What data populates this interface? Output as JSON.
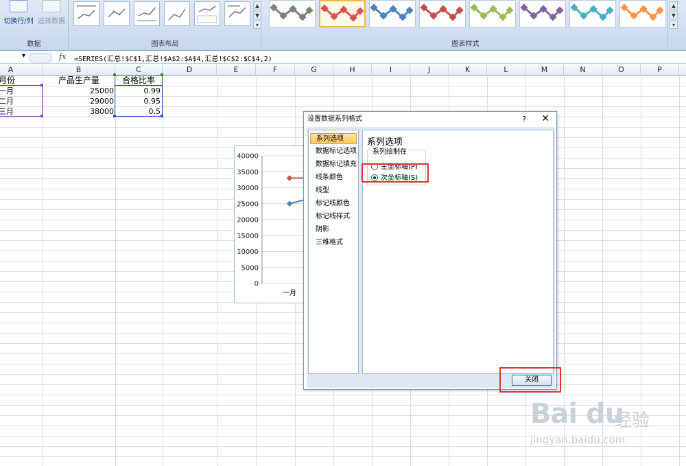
{
  "ribbon": {
    "data_group_label": "数据",
    "switch_row_col": "切换行/列",
    "select_data": "选择数据",
    "layout_group_label": "图表布局",
    "styles_group_label": "图表样式",
    "style_colors": [
      "#7f7f7f",
      "#d9534f",
      "#4f81bd",
      "#c0504d",
      "#9bbb59",
      "#8064a2",
      "#4bacc6",
      "#f79646"
    ],
    "selected_style_index": 1
  },
  "formula_bar": {
    "name_box": "",
    "fx": "fx",
    "formula": "=SERIES(汇总!$C$1,汇总!$A$2:$A$4,汇总!$C$2:$C$4,2)"
  },
  "columns": [
    "A",
    "B",
    "C",
    "D",
    "E",
    "F",
    "G",
    "H",
    "I",
    "J",
    "K",
    "L",
    "M",
    "N",
    "O",
    "P"
  ],
  "sheet": {
    "headers": {
      "a": "月份",
      "b": "产品生产量",
      "c": "合格比率"
    },
    "rows": [
      {
        "a": "一月",
        "b": "25000",
        "c": "0.99"
      },
      {
        "a": "二月",
        "b": "29000",
        "c": "0.95"
      },
      {
        "a": "三月",
        "b": "38000",
        "c": "0.5"
      }
    ]
  },
  "chart_data": {
    "type": "line",
    "y_ticks": [
      "40000",
      "35000",
      "30000",
      "25000",
      "20000",
      "15000",
      "10000",
      "5000",
      "0"
    ],
    "ylim": [
      0,
      40000
    ],
    "categories": [
      "一月"
    ],
    "series": [
      {
        "values": [
          25000
        ],
        "color": "#4f81bd"
      },
      {
        "values": [
          33000
        ],
        "color": "#c0504d"
      }
    ]
  },
  "dialog": {
    "title": "设置数据系列格式",
    "help": "?",
    "close": "✕",
    "nav": [
      "系列选项",
      "数据标记选项",
      "数据标记填充",
      "线条颜色",
      "线型",
      "标记线颜色",
      "标记线样式",
      "阴影",
      "三维格式"
    ],
    "active_nav": 0,
    "panel_title": "系列选项",
    "plot_on_label": "系列绘制在",
    "primary_axis": "主坐标轴(P)",
    "secondary_axis": "次坐标轴(S)",
    "selected_axis": "secondary",
    "close_button": "关闭"
  },
  "watermark": {
    "logo": "Bai du",
    "cn": "经验",
    "url": "jingyan.baidu.com"
  }
}
